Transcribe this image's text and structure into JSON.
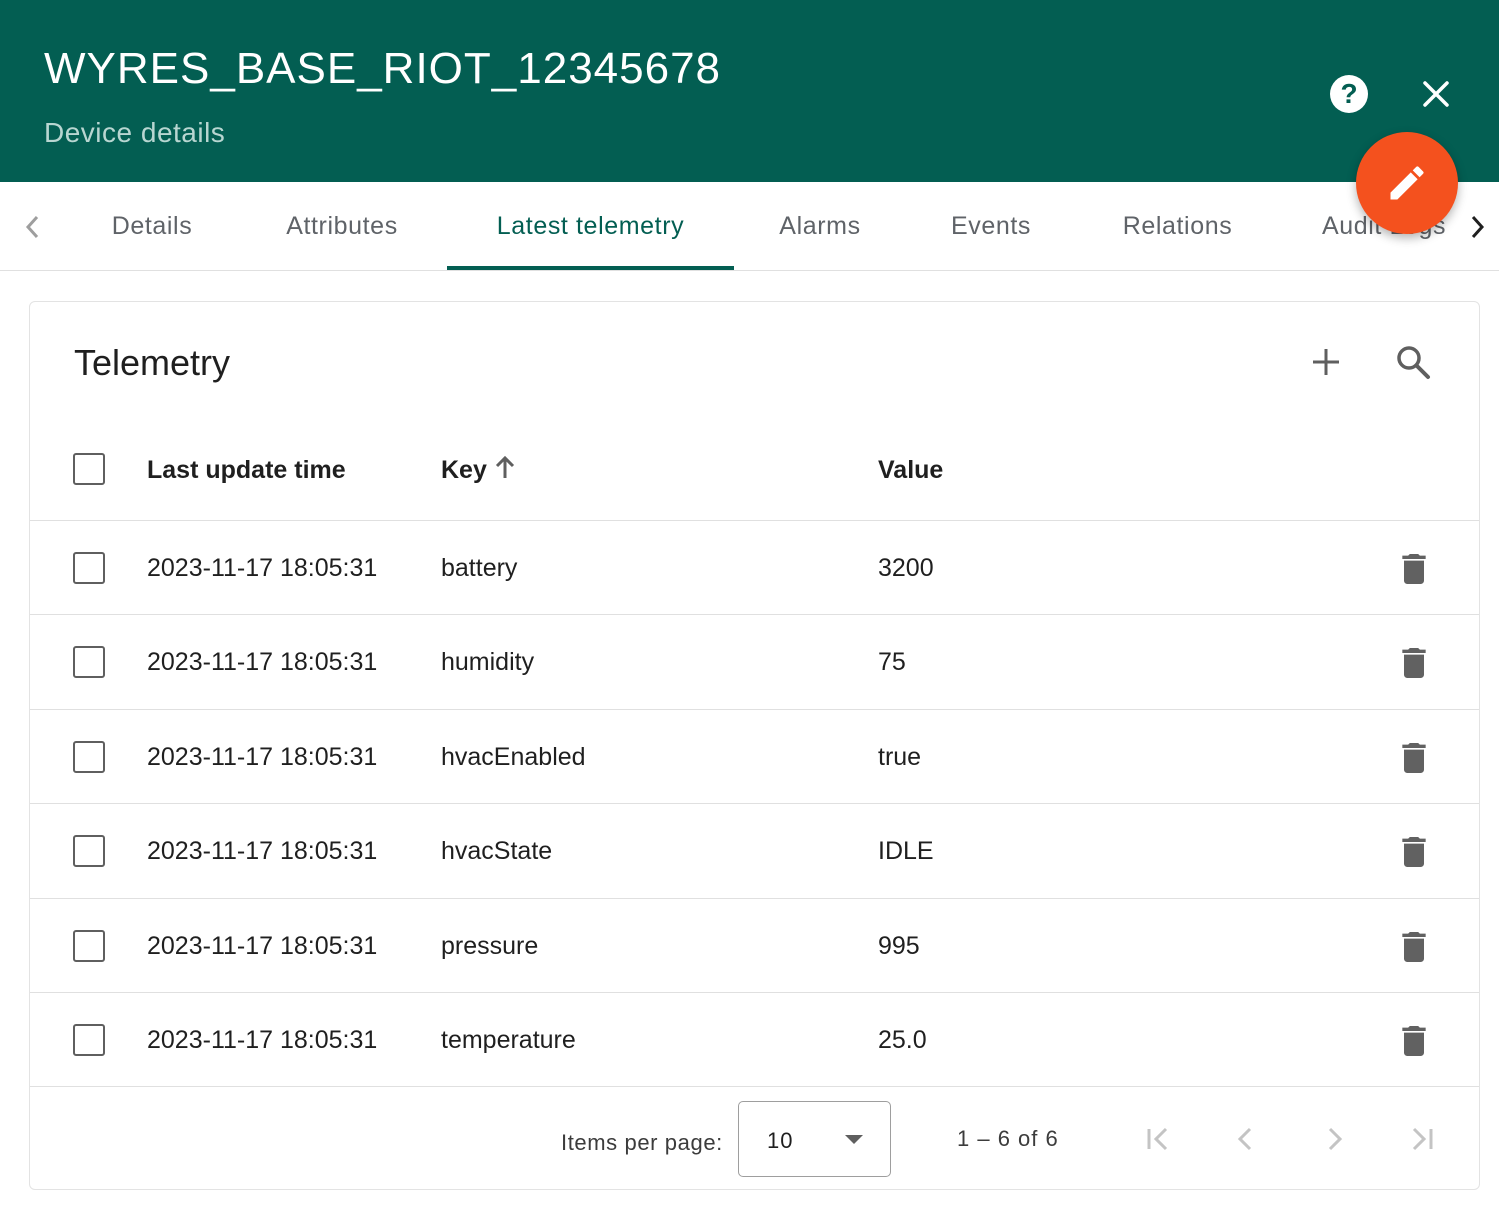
{
  "header": {
    "title": "WYRES_BASE_RIOT_12345678",
    "subtitle": "Device details",
    "help_glyph": "?",
    "help_icon": "help-circle-icon",
    "close_icon": "close-icon",
    "edit_icon": "pencil-icon",
    "background_color": "#035e52",
    "fab_color": "#f4511e"
  },
  "tabs": [
    {
      "label": "Details",
      "active": false
    },
    {
      "label": "Attributes",
      "active": false
    },
    {
      "label": "Latest telemetry",
      "active": true
    },
    {
      "label": "Alarms",
      "active": false
    },
    {
      "label": "Events",
      "active": false
    },
    {
      "label": "Relations",
      "active": false
    },
    {
      "label": "Audit Logs",
      "active": false
    }
  ],
  "card": {
    "title": "Telemetry",
    "add_icon": "plus-icon",
    "search_icon": "search-icon"
  },
  "table": {
    "columns": {
      "last_update_time": "Last update time",
      "key": "Key",
      "value": "Value"
    },
    "sort": {
      "column": "key",
      "direction": "ascending",
      "icon": "arrow-up-icon"
    },
    "rows": [
      {
        "time": "2023-11-17 18:05:31",
        "key": "battery",
        "value": "3200"
      },
      {
        "time": "2023-11-17 18:05:31",
        "key": "humidity",
        "value": "75"
      },
      {
        "time": "2023-11-17 18:05:31",
        "key": "hvacEnabled",
        "value": "true"
      },
      {
        "time": "2023-11-17 18:05:31",
        "key": "hvacState",
        "value": "IDLE"
      },
      {
        "time": "2023-11-17 18:05:31",
        "key": "pressure",
        "value": "995"
      },
      {
        "time": "2023-11-17 18:05:31",
        "key": "temperature",
        "value": "25.0"
      }
    ]
  },
  "paginator": {
    "items_per_page_label": "Items per page:",
    "items_per_page_value": "10",
    "range_label": "1 – 6 of 6"
  }
}
